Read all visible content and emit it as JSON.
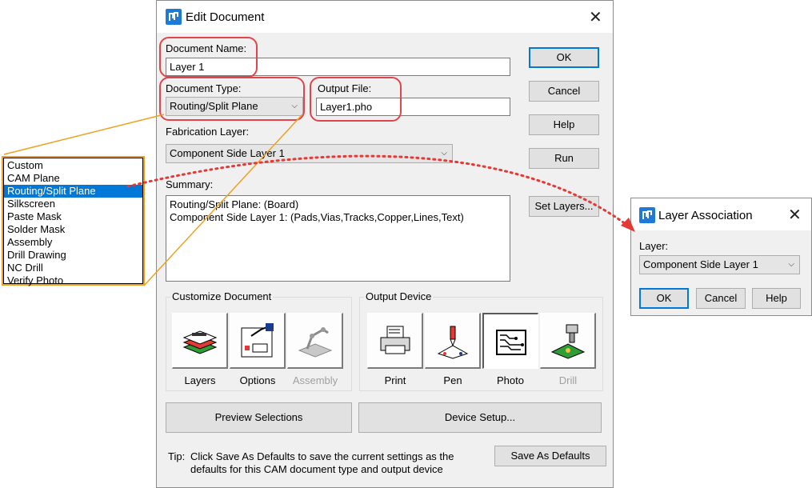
{
  "edit_dialog": {
    "title": "Edit Document",
    "document_name_label": "Document Name:",
    "document_name_value": "Layer 1",
    "document_type_label": "Document Type:",
    "document_type_value": "Routing/Split Plane",
    "output_file_label": "Output File:",
    "output_file_value": "Layer1.pho",
    "fabrication_layer_label": "Fabrication Layer:",
    "fabrication_layer_value": "Component Side Layer 1",
    "summary_label": "Summary:",
    "summary_lines": [
      "Routing/Split Plane: (Board)",
      "Component Side Layer 1: (Pads,Vias,Tracks,Copper,Lines,Text)"
    ],
    "buttons": {
      "ok": "OK",
      "cancel": "Cancel",
      "help": "Help",
      "run": "Run",
      "set_layers": "Set Layers..."
    },
    "customize_document": {
      "label": "Customize Document",
      "items": [
        "Layers",
        "Options",
        "Assembly"
      ]
    },
    "output_device": {
      "label": "Output Device",
      "items": [
        "Print",
        "Pen",
        "Photo",
        "Drill"
      ],
      "selected": "Photo"
    },
    "preview_selections": "Preview Selections",
    "device_setup": "Device Setup...",
    "tip_label": "Tip:",
    "tip_line1": "Click Save As Defaults to save the current settings as the",
    "tip_line2": "defaults for this CAM document type and output device",
    "save_as_defaults": "Save As Defaults"
  },
  "document_type_list": {
    "items": [
      "Custom",
      "CAM Plane",
      "Routing/Split Plane",
      "Silkscreen",
      "Paste Mask",
      "Solder Mask",
      "Assembly",
      "Drill Drawing",
      "NC Drill",
      "Verify Photo"
    ],
    "selected_index": 2
  },
  "layer_dialog": {
    "title": "Layer Association",
    "layer_label": "Layer:",
    "layer_value": "Component Side Layer 1",
    "buttons": {
      "ok": "OK",
      "cancel": "Cancel",
      "help": "Help"
    }
  },
  "colors": {
    "highlight": "#e0454c",
    "callout": "#f0a020",
    "arrow": "#e53935",
    "selection": "#0078d7"
  }
}
